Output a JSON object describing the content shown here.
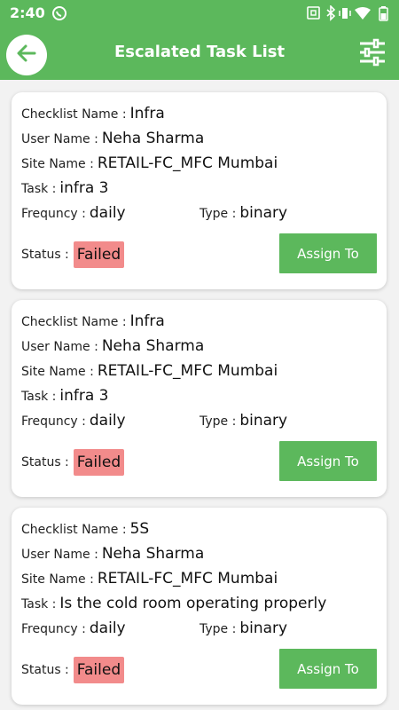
{
  "status_bar": {
    "time": "2:40",
    "icons": [
      "whatsapp-icon",
      "nfc-icon",
      "bluetooth-icon",
      "vibrate-icon",
      "wifi-icon",
      "battery-icon"
    ]
  },
  "app_bar": {
    "title": "Escalated Task List",
    "back_icon": "arrow-left-icon",
    "filter_icon": "sliders-icon"
  },
  "colors": {
    "primary": "#5cb85c",
    "failed_badge": "#f28b8b",
    "background": "#f2f2f2"
  },
  "labels": {
    "checklist_name": "Checklist Name :",
    "user_name": "User Name :",
    "site_name": "Site Name :",
    "task": "Task :",
    "frequency": "Frequncy :",
    "type": "Type :",
    "status": "Status :",
    "assign_button": "Assign To"
  },
  "tasks": [
    {
      "checklist_name": "Infra",
      "user_name": "Neha Sharma",
      "site_name": "RETAIL-FC_MFC Mumbai",
      "task": "infra 3",
      "frequency": "daily",
      "type": "binary",
      "status": "Failed"
    },
    {
      "checklist_name": "Infra",
      "user_name": "Neha Sharma",
      "site_name": "RETAIL-FC_MFC Mumbai",
      "task": "infra 3",
      "frequency": "daily",
      "type": "binary",
      "status": "Failed"
    },
    {
      "checklist_name": "5S",
      "user_name": "Neha Sharma",
      "site_name": "RETAIL-FC_MFC Mumbai",
      "task": "Is the cold room operating properly",
      "frequency": "daily",
      "type": "binary",
      "status": "Failed"
    }
  ]
}
